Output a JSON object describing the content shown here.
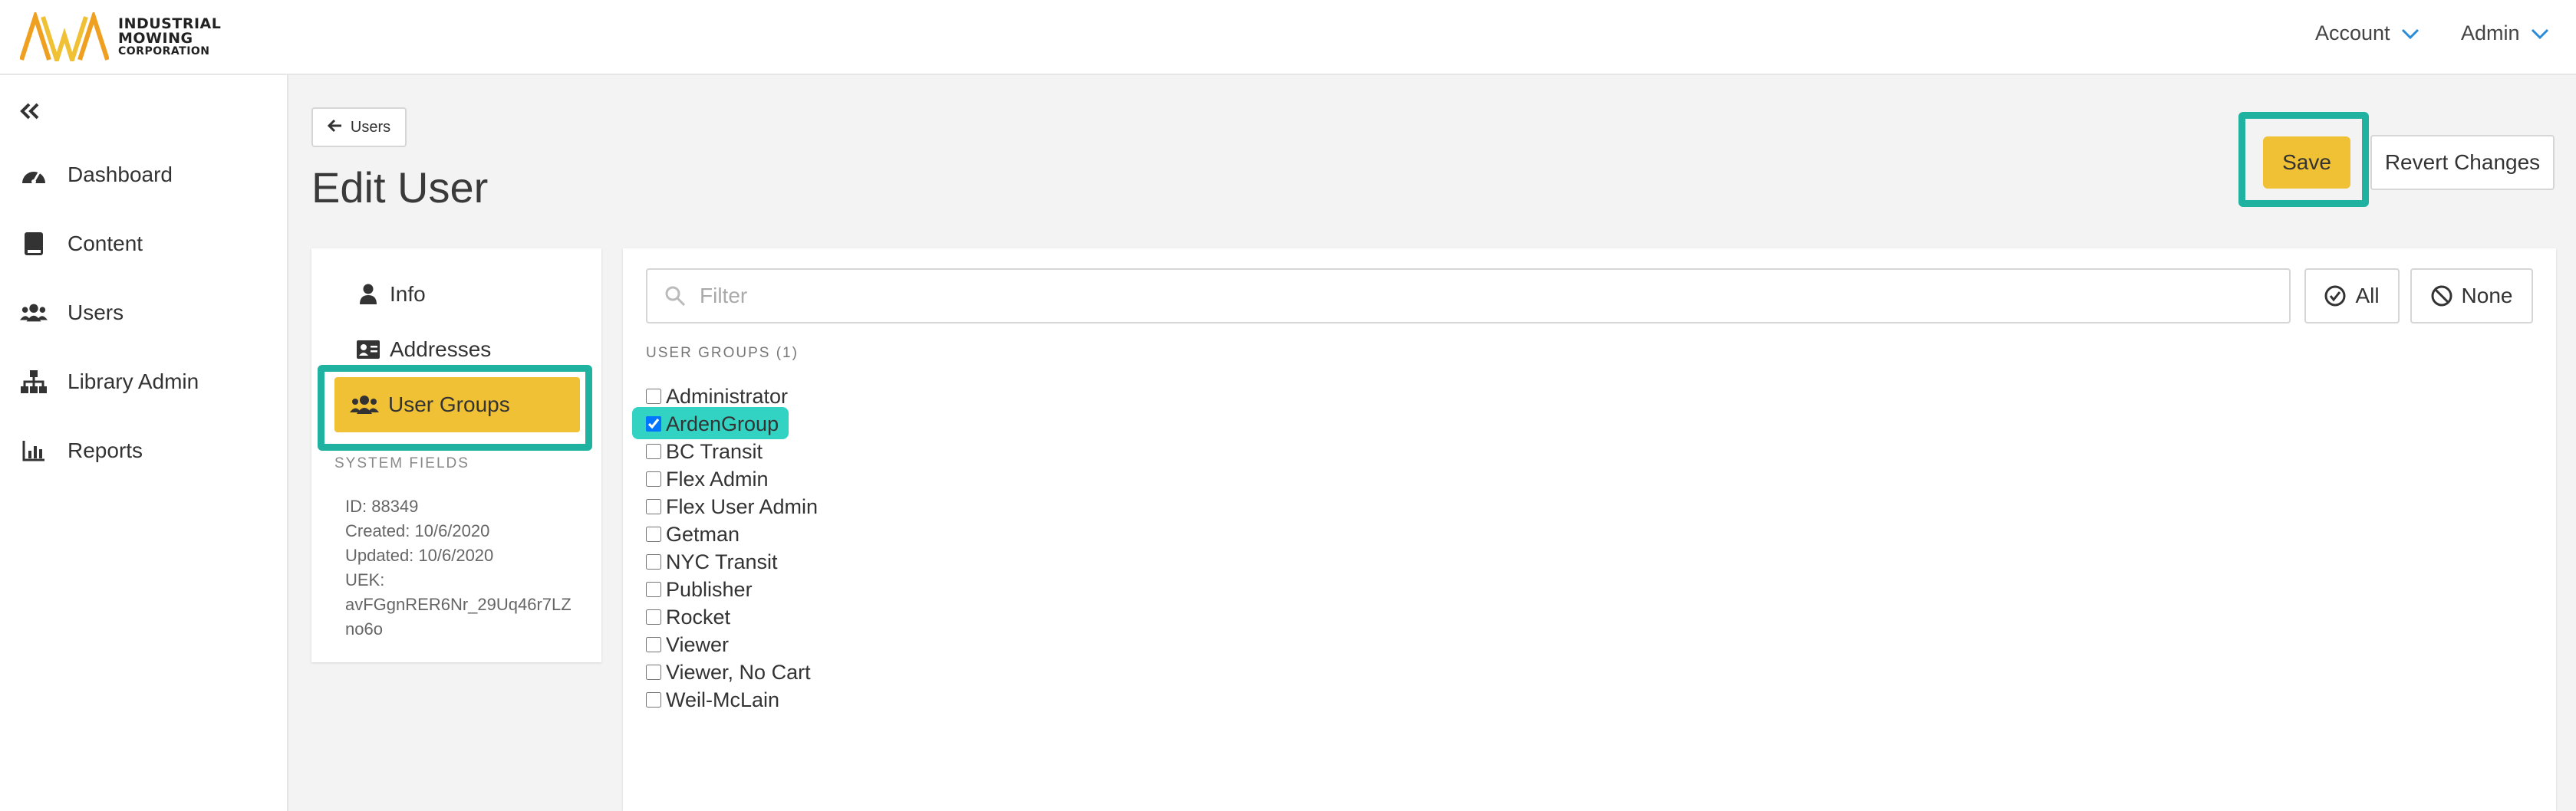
{
  "brand": {
    "line1": "INDUSTRIAL",
    "line2": "MOWING",
    "line3": "CORPORATION",
    "colors": {
      "orange": "#f0a020",
      "yellow": "#f0c134"
    }
  },
  "topnav": {
    "account_label": "Account",
    "admin_label": "Admin"
  },
  "sidebar": {
    "collapse_icon": "chevron-double-left-icon",
    "items": [
      {
        "label": "Dashboard",
        "icon": "dashboard-icon"
      },
      {
        "label": "Content",
        "icon": "book-icon"
      },
      {
        "label": "Users",
        "icon": "users-icon"
      },
      {
        "label": "Library Admin",
        "icon": "sitemap-icon"
      },
      {
        "label": "Reports",
        "icon": "chart-icon"
      }
    ]
  },
  "breadcrumb": {
    "back_label": "Users"
  },
  "page": {
    "title": "Edit User"
  },
  "actions": {
    "save_label": "Save",
    "revert_label": "Revert Changes"
  },
  "tabs": [
    {
      "label": "Info",
      "icon": "user-icon"
    },
    {
      "label": "Addresses",
      "icon": "id-card-icon"
    },
    {
      "label": "User Groups",
      "icon": "users-icon",
      "active": true
    }
  ],
  "system_fields": {
    "heading": "SYSTEM FIELDS",
    "id": "ID: 88349",
    "created": "Created: 10/6/2020",
    "updated": "Updated: 10/6/2020",
    "uek_label": "UEK:",
    "uek_value_1": "avFGgnRER6Nr_29Uq46r7LZ",
    "uek_value_2": "no6o"
  },
  "filter": {
    "placeholder": "Filter",
    "all_label": "All",
    "none_label": "None"
  },
  "user_groups": {
    "heading": "USER GROUPS (1)",
    "items": [
      {
        "label": "Administrator",
        "checked": false
      },
      {
        "label": "ArdenGroup",
        "checked": true
      },
      {
        "label": "BC Transit",
        "checked": false
      },
      {
        "label": "Flex Admin",
        "checked": false
      },
      {
        "label": "Flex User Admin",
        "checked": false
      },
      {
        "label": "Getman",
        "checked": false
      },
      {
        "label": "NYC Transit",
        "checked": false
      },
      {
        "label": "Publisher",
        "checked": false
      },
      {
        "label": "Rocket",
        "checked": false
      },
      {
        "label": "Viewer",
        "checked": false
      },
      {
        "label": "Viewer, No Cart",
        "checked": false
      },
      {
        "label": "Weil-McLain",
        "checked": false
      }
    ]
  },
  "highlight_color": "#20b2a1"
}
